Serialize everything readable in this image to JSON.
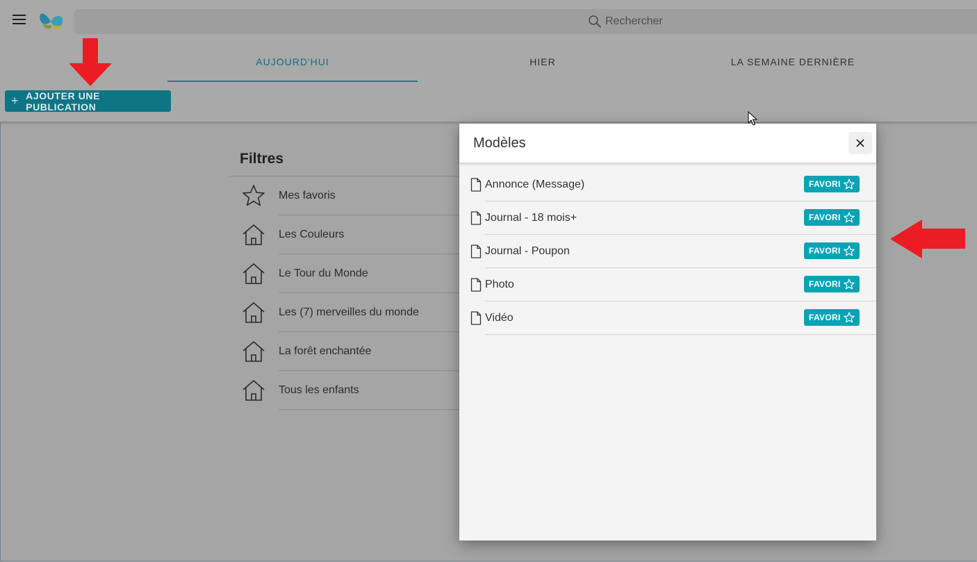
{
  "topbar": {
    "search_placeholder": "Rechercher",
    "menu_icon": "menu-icon",
    "logo_icon": "butterfly-logo-icon"
  },
  "tabs": [
    {
      "label": "AUJOURD'HUI",
      "active": true
    },
    {
      "label": "HIER",
      "active": false
    },
    {
      "label": "LA SEMAINE DERNIÈRE",
      "active": false
    }
  ],
  "actions": {
    "add_publication_label": "AJOUTER UNE PUBLICATION"
  },
  "filters": {
    "title": "Filtres",
    "items": [
      {
        "label": "Mes favoris",
        "icon": "star-icon"
      },
      {
        "label": "Les Couleurs",
        "icon": "home-icon"
      },
      {
        "label": "Le Tour du Monde",
        "icon": "home-icon"
      },
      {
        "label": "Les (7) merveilles du monde",
        "icon": "home-icon"
      },
      {
        "label": "La forêt enchantée",
        "icon": "home-icon"
      },
      {
        "label": "Tous les enfants",
        "icon": "home-icon"
      }
    ]
  },
  "modal": {
    "title": "Modèles",
    "close_icon": "close-icon",
    "favorite_label": "FAVORI",
    "items": [
      {
        "label": "Annonce (Message)"
      },
      {
        "label": "Journal - 18 mois+"
      },
      {
        "label": "Journal - Poupon"
      },
      {
        "label": "Photo"
      },
      {
        "label": "Vidéo"
      }
    ]
  },
  "colors": {
    "accent": "#0aa3b4",
    "annotation_arrow": "#ec1c24"
  }
}
